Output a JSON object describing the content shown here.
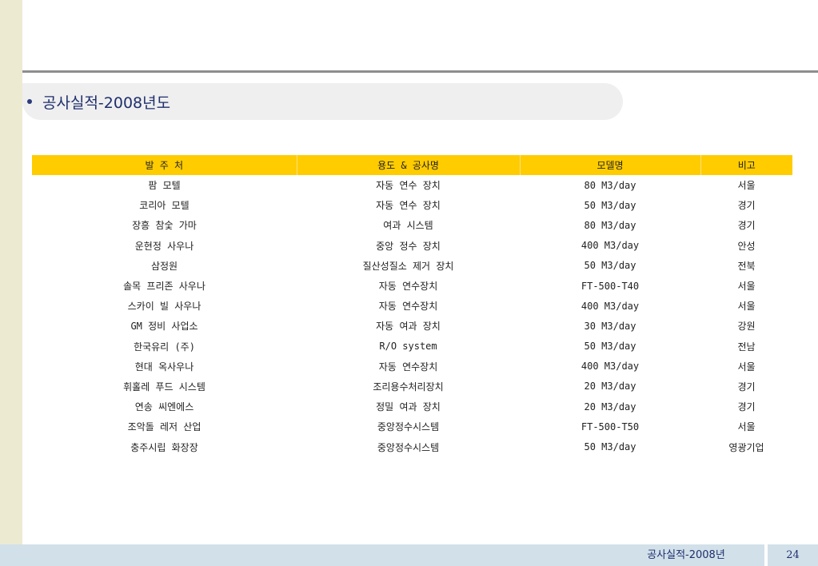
{
  "heading": "공사실적-2008년도",
  "table": {
    "headers": [
      "발 주 처",
      "용도 & 공사명",
      "모델명",
      "비고"
    ],
    "rows": [
      [
        "팜 모텔",
        "자동 연수 장치",
        "80 M3/day",
        "서울"
      ],
      [
        "코리아 모텔",
        "자동 연수 장치",
        "50 M3/day",
        "경기"
      ],
      [
        "장흥 참숯 가마",
        "여과 시스템",
        "80 M3/day",
        "경기"
      ],
      [
        "운현정 사우나",
        "중앙 정수 장치",
        "400 M3/day",
        "안성"
      ],
      [
        "삼정원",
        "질산성질소 제거 장치",
        "50 M3/day",
        "전북"
      ],
      [
        "솔목 프리존 사우나",
        "자동 연수장치",
        "FT-500-T40",
        "서울"
      ],
      [
        "스카이 빌 사우나",
        "자동 연수장치",
        "400 M3/day",
        "서울"
      ],
      [
        "GM 정비 사업소",
        "자동 여과 장치",
        "30 M3/day",
        "강원"
      ],
      [
        "한국유리 (주)",
        "R/O system",
        "50 M3/day",
        "전남"
      ],
      [
        "현대 옥사우나",
        "자동 연수장치",
        "400 M3/day",
        "서울"
      ],
      [
        "휘홀레 푸드 시스템",
        "조리용수처리장치",
        "20 M3/day",
        "경기"
      ],
      [
        "연송 씨엔에스",
        "정밀 여과 장치",
        "20 M3/day",
        "경기"
      ],
      [
        "조악돌 레저 산업",
        "중앙정수시스템",
        "FT-500-T50",
        "서울"
      ],
      [
        "충주시립 화장장",
        "중앙정수시스템",
        "50 M3/day",
        "영광기업"
      ]
    ]
  },
  "footer": {
    "title": "공사실적-2008년",
    "page_number": "24"
  },
  "colors": {
    "header_fill": "#ffcc00",
    "footer_fill": "#d2e0e9",
    "left_strip": "#ecebd1",
    "heading_text": "#1f2f6e"
  }
}
